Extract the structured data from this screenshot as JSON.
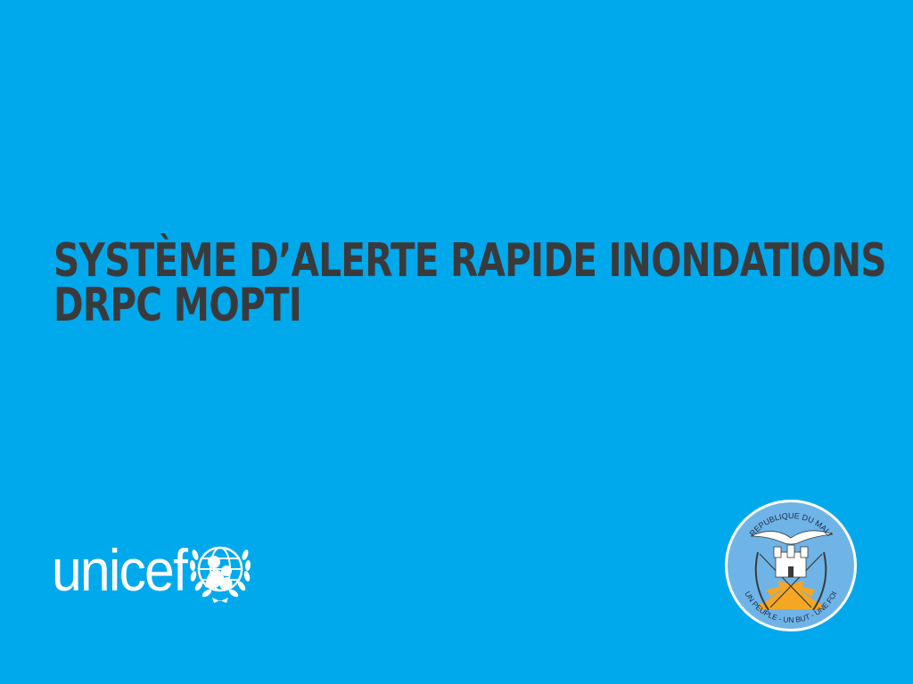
{
  "slide": {
    "title_line1": "SYSTÈME D’ALERTE RAPIDE INONDATIONS",
    "title_line2": "DRPC MOPTI"
  },
  "logos": {
    "unicef": {
      "wordmark": "unicef",
      "icon": "unicef-globe-icon"
    },
    "mali_seal": {
      "top_text": "REPUBLIQUE DU MALI",
      "bottom_text": "UN PEUPLE - UN BUT - UNE FOI",
      "icon": "mali-coat-of-arms-icon"
    }
  },
  "colors": {
    "background": "#00A9EC",
    "title_text": "#3A3A3C",
    "logo_white": "#FFFFFF",
    "seal_fill": "#6FB4E6",
    "seal_sun": "#F5A623"
  }
}
